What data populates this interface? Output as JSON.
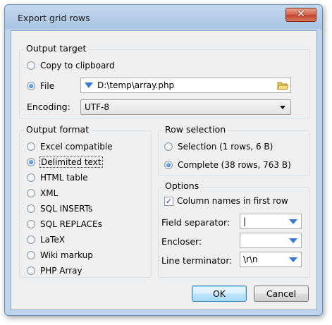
{
  "window": {
    "title": "Export grid rows",
    "close_glyph": "✕"
  },
  "output_target": {
    "title": "Output target",
    "options": [
      {
        "label": "Copy to clipboard",
        "selected": false
      },
      {
        "label": "File",
        "selected": true
      }
    ],
    "file_path": "D:\\temp\\array.php",
    "encoding_label": "Encoding:",
    "encoding_value": "UTF-8"
  },
  "output_format": {
    "title": "Output format",
    "options": [
      {
        "label": "Excel compatible",
        "selected": false
      },
      {
        "label": "Delimited text",
        "selected": true
      },
      {
        "label": "HTML table",
        "selected": false
      },
      {
        "label": "XML",
        "selected": false
      },
      {
        "label": "SQL INSERTs",
        "selected": false
      },
      {
        "label": "SQL REPLACEs",
        "selected": false
      },
      {
        "label": "LaTeX",
        "selected": false
      },
      {
        "label": "Wiki markup",
        "selected": false
      },
      {
        "label": "PHP Array",
        "selected": false
      }
    ]
  },
  "row_selection": {
    "title": "Row selection",
    "options": [
      {
        "label": "Selection (1 rows, 6 B)",
        "selected": false
      },
      {
        "label": "Complete (38 rows, 763 B)",
        "selected": true
      }
    ]
  },
  "options": {
    "title": "Options",
    "column_names_label": "Column names in first row",
    "column_names_checked": true,
    "field_separator_label": "Field separator:",
    "field_separator_value": "|",
    "encloser_label": "Encloser:",
    "encloser_value": "",
    "line_terminator_label": "Line terminator:",
    "line_terminator_value": "\\r\\n"
  },
  "buttons": {
    "ok": "OK",
    "cancel": "Cancel"
  },
  "icons": {
    "file_type": "dropdown-arrow-icon",
    "browse": "folder-open-icon"
  },
  "colors": {
    "accent": "#3a78d8",
    "title_bar": "#bed3ec"
  }
}
